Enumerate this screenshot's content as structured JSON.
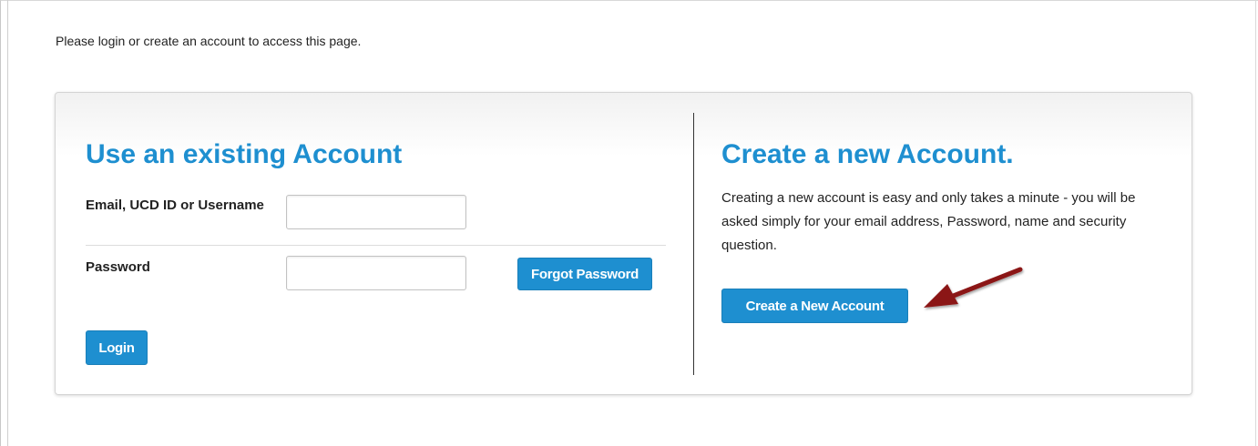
{
  "intro_text": "Please login or create an account to access this page.",
  "existing": {
    "heading": "Use an existing Account",
    "email_label": "Email, UCD ID or Username",
    "email_value": "",
    "password_label": "Password",
    "password_value": "",
    "forgot_label": "Forgot Password",
    "login_label": "Login"
  },
  "create": {
    "heading": "Create a new Account.",
    "description": "Creating a new account is easy and only takes a minute - you will be asked simply for your email address, Password, name and security question.",
    "button_label": "Create a New Account"
  },
  "colors": {
    "accent": "#1e8fd0",
    "annotation_arrow": "#8b1414"
  },
  "icons": {
    "annotation": "arrow-annotation-icon"
  }
}
